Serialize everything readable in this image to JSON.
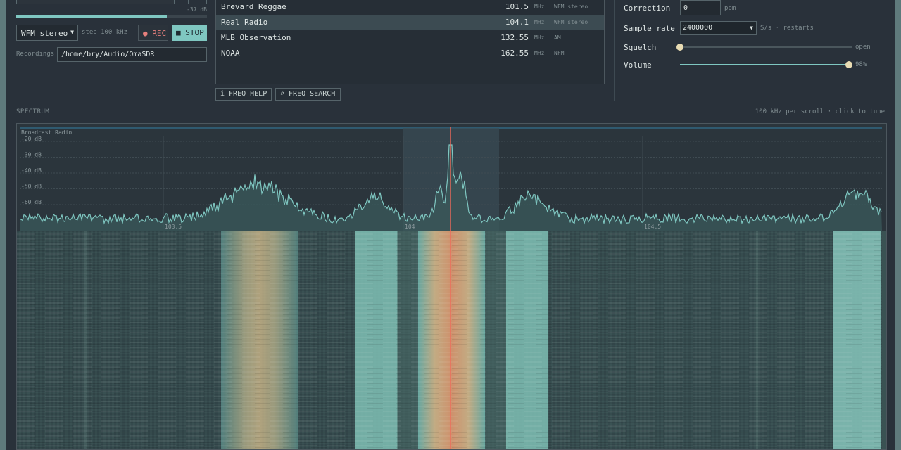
{
  "recorder": {
    "level_db": "-37 dB",
    "level_fraction": 0.79,
    "mode": "WFM stereo",
    "step": "step 100 kHz",
    "rec_label": "REC",
    "stop_label": "STOP",
    "recordings_label": "Recordings",
    "recordings_path": "/home/bry/Audio/OmaSDR"
  },
  "stations": [
    {
      "name": "Brevard Reggae",
      "freq": "101.5",
      "unit": "MHz",
      "mode": "WFM stereo",
      "selected": false
    },
    {
      "name": "Real Radio",
      "freq": "104.1",
      "unit": "MHz",
      "mode": "WFM stereo",
      "selected": true
    },
    {
      "name": "MLB Observation",
      "freq": "132.55",
      "unit": "MHz",
      "mode": "AM",
      "selected": false
    },
    {
      "name": "NOAA",
      "freq": "162.55",
      "unit": "MHz",
      "mode": "NFM",
      "selected": false
    }
  ],
  "buttons": {
    "freq_help": "i FREQ HELP",
    "freq_search": "⌕ FREQ SEARCH"
  },
  "settings": {
    "correction_label": "Correction",
    "correction_value": "0",
    "correction_unit": "ppm",
    "sample_rate_label": "Sample rate",
    "sample_rate_value": "2400000",
    "sample_rate_note": "S/s · restarts",
    "squelch_label": "Squelch",
    "squelch_value": "open",
    "squelch_fraction": 0.0,
    "volume_label": "Volume",
    "volume_value": "98%",
    "volume_fraction": 0.98
  },
  "spectrum": {
    "title": "SPECTRUM",
    "hint": "100 kHz per scroll · click to tune",
    "band_label": "Broadcast Radio",
    "db_ticks": [
      "-20 dB",
      "-30 dB",
      "-40 dB",
      "-50 dB",
      "-60 dB"
    ],
    "freq_ticks": [
      "103.5",
      "104",
      "104.5"
    ],
    "tuned_mhz": 104.1
  },
  "colors": {
    "accent": "#7fc7c1",
    "rec": "#e57f7c",
    "marker": "#f06a5a",
    "knob": "#e9dcb3"
  }
}
